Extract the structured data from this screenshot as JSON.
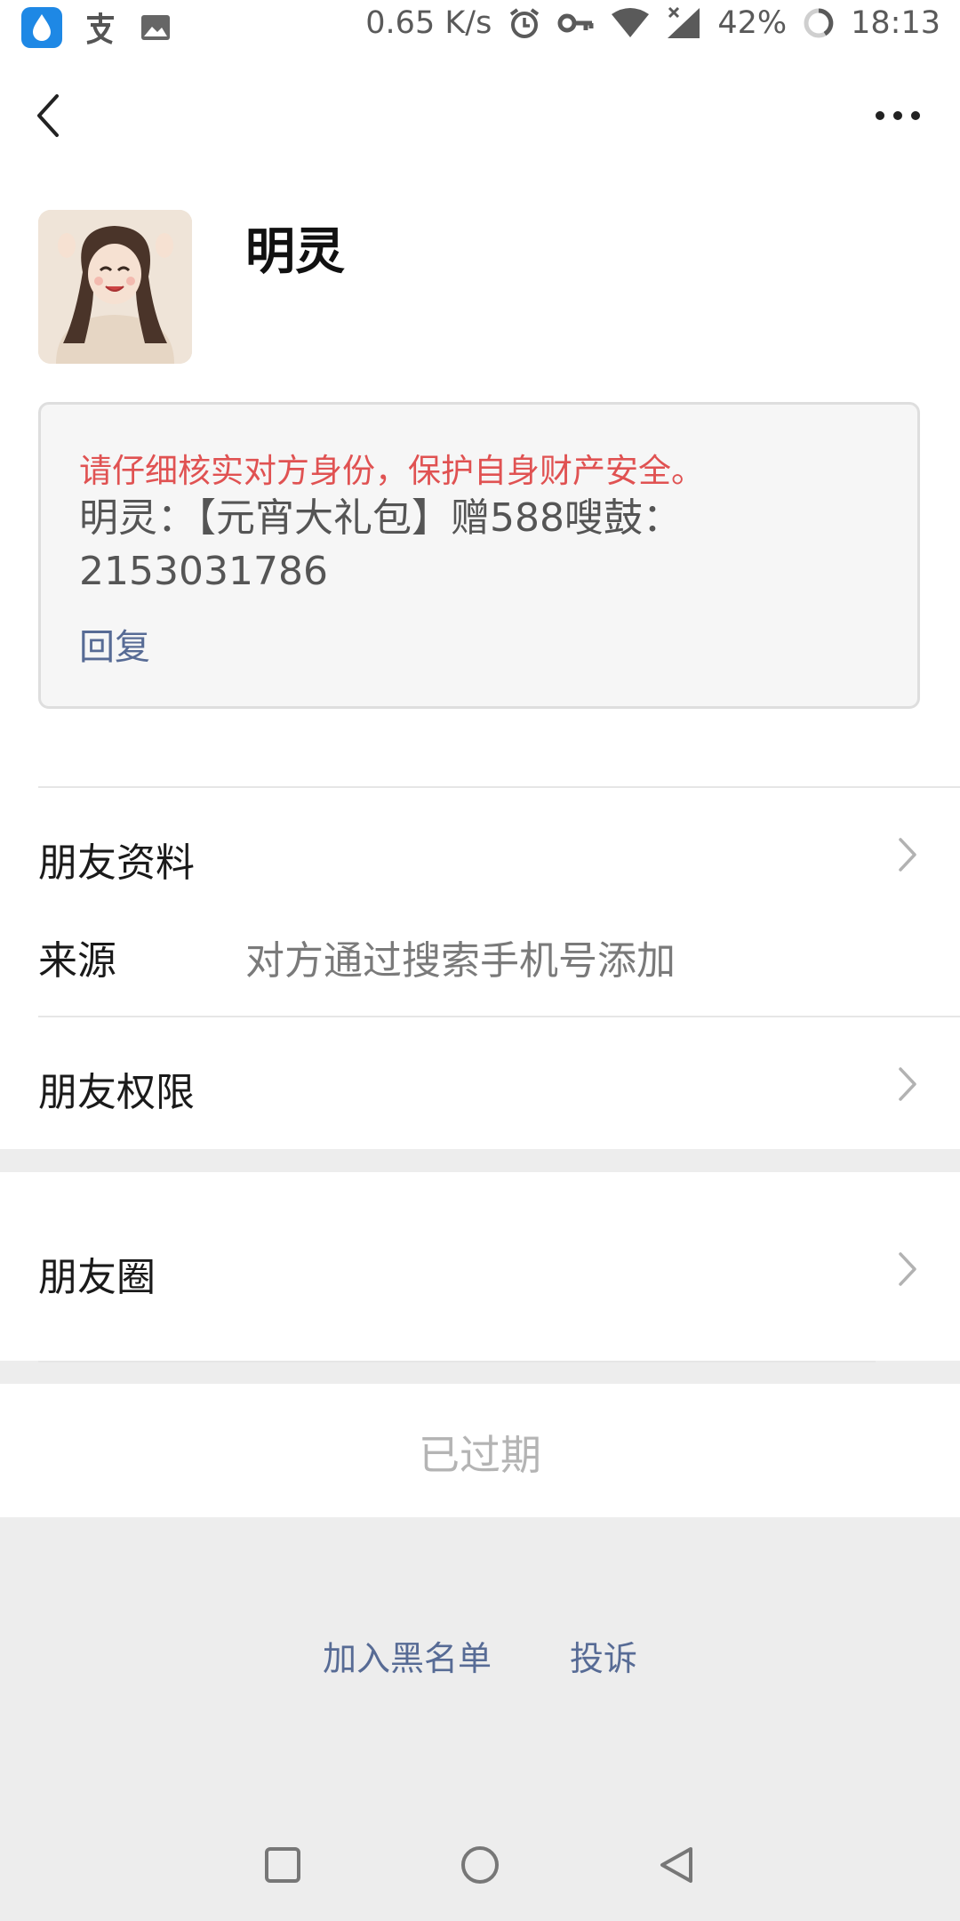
{
  "status_bar": {
    "speed": "0.65 K/s",
    "battery": "42%",
    "time": "18:13"
  },
  "profile": {
    "name": "明灵"
  },
  "message_card": {
    "warning": "请仔细核实对方身份，保护自身财产安全。",
    "message": "明灵：【元宵大礼包】赠588嗖鼓：2153031786",
    "reply_label": "回复"
  },
  "rows": {
    "friend_info": "朋友资料",
    "source_label": "来源",
    "source_value": "对方通过搜索手机号添加",
    "friend_permissions": "朋友权限",
    "moments": "朋友圈"
  },
  "expired_label": "已过期",
  "footer": {
    "blacklist": "加入黑名单",
    "report": "投诉"
  },
  "colors": {
    "warning": "#e05252",
    "link": "#576b95",
    "background": "#ededed"
  },
  "icons": [
    "back-arrow-icon",
    "more-dots-icon",
    "chevron-right-icon",
    "square-nav-icon",
    "circle-nav-icon",
    "triangle-back-nav-icon"
  ]
}
